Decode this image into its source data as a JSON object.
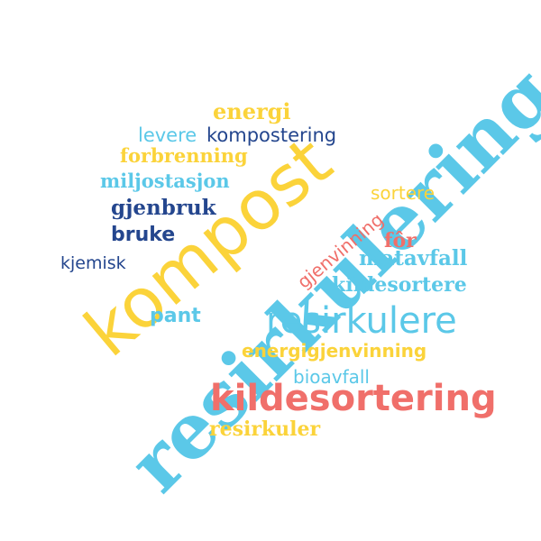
{
  "palette": {
    "yellow": "#fbd33a",
    "light_blue": "#5bc8e8",
    "navy": "#24468e",
    "coral": "#f06f6a"
  },
  "words": {
    "energi": "energi",
    "levere": "levere",
    "kompostering": "kompostering",
    "forbrenning": "forbrenning",
    "miljostasjon": "miljostasjon",
    "sortere": "sortere",
    "gjenbruk": "gjenbruk",
    "bruke": "bruke",
    "gjenvinning": "gjenvinning",
    "for": "fôr",
    "kjemisk": "kjemisk",
    "matavfall": "matavfall",
    "kildesortere": "kildesortere",
    "pant": "pant",
    "resirkulere": "resirkulere",
    "energigjenvinning": "energigjenvinning",
    "bioavfall": "bioavfall",
    "kildesortering": "kildesortering",
    "resirkuler": "resirkuler",
    "kompost": "kompost",
    "resirkulering": "resirkulering"
  }
}
